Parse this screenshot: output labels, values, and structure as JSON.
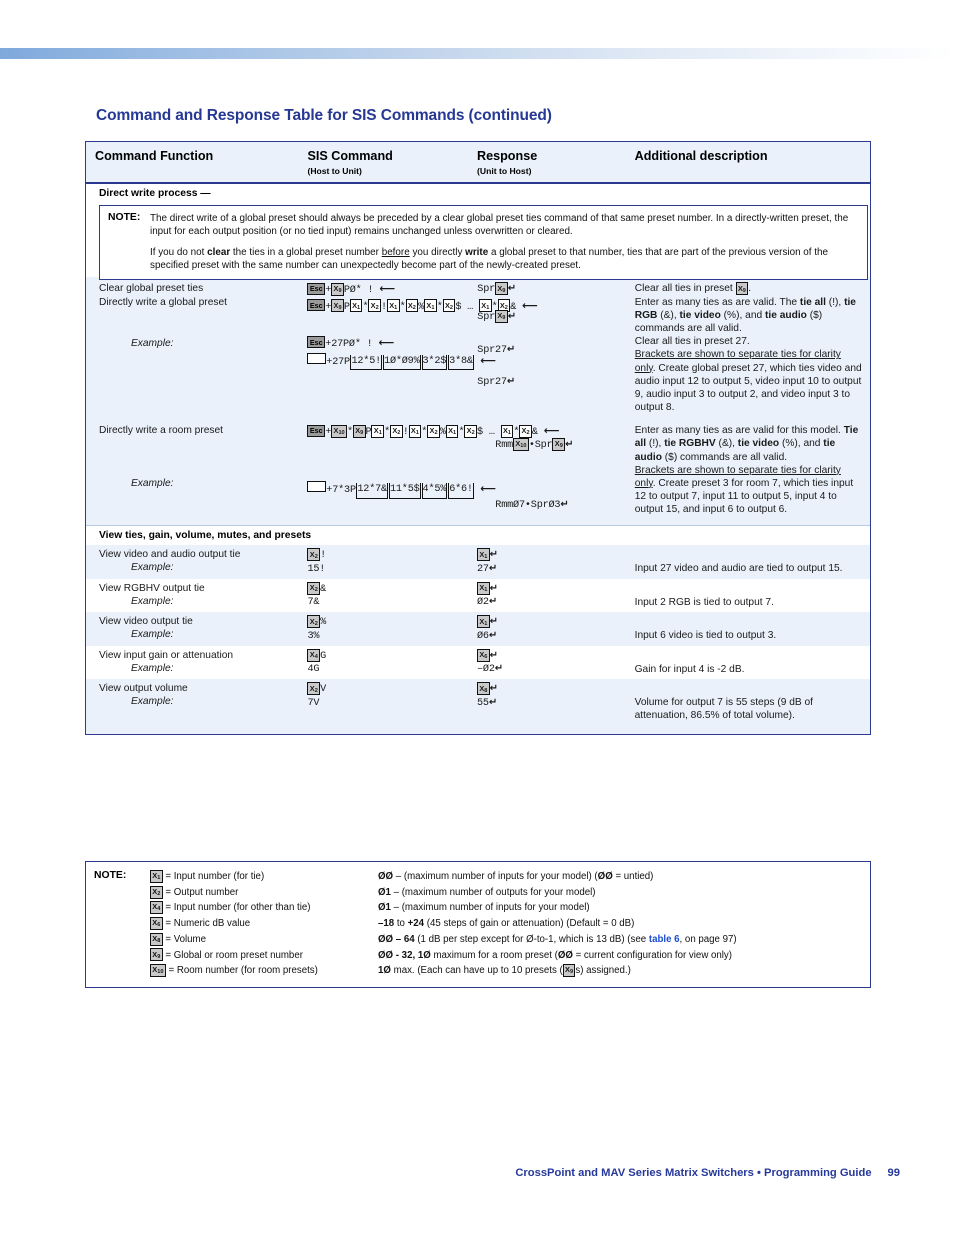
{
  "page": {
    "title": "Command and Response Table for SIS Commands (continued)",
    "footer_text": "CrossPoint and MAV Series Matrix Switchers • Programming Guide",
    "page_number": "99",
    "accent_color": "#26389b",
    "rule_color": "#2b3a8f",
    "shade_color": "#eaf1fa"
  },
  "table": {
    "headers": {
      "col1": "Command Function",
      "col2": "SIS Command",
      "col2_sub": "(Host to Unit)",
      "col3": "Response",
      "col3_sub": "(Unit to Host)",
      "col4": "Additional description"
    },
    "section_direct_write": "Direct write process —",
    "section_view": "View ties, gain, volume, mutes, and presets"
  },
  "note_top": {
    "label": "NOTE:",
    "paragraph1_a": "The direct write of a global preset should always be preceded by a clear global preset ties command of that same preset number. In a directly-written preset, the input for each output position (or no tied input) remains unchanged unless overwritten or cleared.",
    "paragraph2_a": "If you do not ",
    "paragraph2_clear": "clear",
    "paragraph2_b": " the ties in a global preset number ",
    "paragraph2_before": "before",
    "paragraph2_c": " you directly ",
    "paragraph2_write": "write",
    "paragraph2_d": " a global preset to that number, ties that are part of the previous version of the specified preset with the same number can unexpectedly become part of the newly-created preset."
  },
  "rows": {
    "clear_global_preset_ties": {
      "function": "Clear global preset ties",
      "description": "Clear all ties in preset "
    },
    "directly_write_global_preset": {
      "function": "Directly write a global preset",
      "desc_a": "Enter as many ties as are valid. The ",
      "desc_tie_all": "tie all",
      "desc_b": " (!), ",
      "desc_tie_rgb": "tie RGB",
      "desc_c": " (&), ",
      "desc_tie_video": "tie video",
      "desc_d": " (%), and ",
      "desc_tie_audio": "tie audio",
      "desc_e": " ($) commands are all valid."
    },
    "global_example": {
      "label": "Example:",
      "desc_clear": "Clear all ties in preset 27.",
      "desc_brackets": "Brackets are shown to separate ties for clarity only",
      "desc_rest": ". Create global preset 27, which ties video and audio input 12 to output 5, video input 10 to output 9, audio input 3 to output 2, and video input 3 to output 8."
    },
    "directly_write_room_preset": {
      "function": "Directly write a room preset",
      "desc_a": "Enter as many ties as are valid for this model. ",
      "desc_tie_all": "Tie all",
      "desc_b": " (!), ",
      "desc_tie_rgbhv": "tie RGBHV",
      "desc_c": " (&), ",
      "desc_tie_video": "tie video",
      "desc_d": " (%), and ",
      "desc_tie_audio": "tie audio",
      "desc_e": " ($) commands are all valid."
    },
    "room_example": {
      "label": "Example:",
      "desc_brackets": "Brackets are shown to separate ties for clarity only",
      "desc_rest": ". Create preset 3 for room 7, which ties input 12 to output 7, input 11 to output 5, input 4 to output 15, and input 6 to output 6."
    },
    "view_video_audio_tie": {
      "function": "View video and audio output tie",
      "example_label": "Example:",
      "example_sis": "15!",
      "example_resp": "27",
      "example_desc": "Input 27 video and audio are tied to output 15."
    },
    "view_rgbhv_tie": {
      "function": "View RGBHV output tie",
      "example_label": "Example:",
      "example_sis": "7&",
      "example_resp": "Ø2",
      "example_desc": "Input 2 RGB is tied to output 7."
    },
    "view_video_tie": {
      "function": "View video output tie",
      "example_label": "Example:",
      "example_sis": "3%",
      "example_resp": "Ø6",
      "example_desc": "Input 6 video is tied to output 3."
    },
    "view_input_gain": {
      "function": "View input gain or attenuation",
      "example_label": "Example:",
      "example_sis": "4G",
      "example_resp": "–Ø2",
      "example_desc": "Gain for input 4 is -2 dB."
    },
    "view_output_volume": {
      "function": "View output volume",
      "example_label": "Example:",
      "example_sis": "7V",
      "example_resp": "55",
      "example_desc": "Volume for output 7 is 55 steps (9 dB of attenuation, 86.5% of total volume)."
    }
  },
  "note_bottom": {
    "label": "NOTE:",
    "variables": [
      {
        "chip": "X1",
        "sub": "1",
        "text": "= Input number (for tie)"
      },
      {
        "chip": "X2",
        "sub": "2",
        "text": "= Output number"
      },
      {
        "chip": "X4",
        "sub": "4",
        "text": "= Input number (for other than tie)"
      },
      {
        "chip": "X6",
        "sub": "6",
        "text": "= Numeric dB value"
      },
      {
        "chip": "X8",
        "sub": "8",
        "text": "= Volume"
      },
      {
        "chip": "X9",
        "sub": "9",
        "text": "= Global or room preset number"
      },
      {
        "chip": "X10",
        "sub": "10",
        "text": "= Room number (for room presets)"
      }
    ],
    "definitions": {
      "d1_bold": "ØØ",
      "d1_rest": " – (maximum number of inputs for your model)  (",
      "d1_bold2": "ØØ",
      "d1_tail": " = untied)",
      "d2_bold": "Ø1",
      "d2_rest": " – (maximum number of outputs for your model)",
      "d3_bold": "Ø1",
      "d3_rest": " – (maximum number of inputs for your model)",
      "d4_bold": "–18",
      "d4_mid": " to ",
      "d4_bold2": "+24",
      "d4_rest": " (45 steps of gain or attenuation) (Default = 0 dB)",
      "d5_bold": "ØØ – ",
      "d5_bold2": "64",
      "d5_rest": " (1 dB per step except for Ø-to-1, which is 13 dB) (see ",
      "d5_link": "table 6",
      "d5_tail": ", on page 97)",
      "d6_bold": "ØØ - 32, 1Ø",
      "d6_rest": " maximum for a room preset (",
      "d6_bold2": "ØØ",
      "d6_tail": " = current configuration for view only)",
      "d7_bold": "1Ø",
      "d7_rest": " max. (Each can have up to 10 presets (",
      "d7_chip": "X9",
      "d7_tail": "s) assigned.)"
    }
  },
  "sis_literals": {
    "esc": "Esc",
    "plus": "+",
    "p": "P",
    "clear_tail": "PØ* !",
    "spr": "Spr",
    "rmm": "Rmm",
    "global_ex_clear": "+27PØ* !",
    "global_ex_resp1": "Spr27",
    "global_ex_resp2": "Spr27",
    "global_ex_g1": "12*5!",
    "global_ex_g2": "1Ø*Ø9%",
    "global_ex_g3": "3*2$",
    "global_ex_g4": "3*8&",
    "global_ex_pre": "+27P",
    "room_ex_pre": "+7*3P",
    "room_ex_g1": "12*7&",
    "room_ex_g2": "11*5$",
    "room_ex_g3": "4*5%",
    "room_ex_g4": "6*6!",
    "room_ex_resp": "RmmØ7•SprØ3",
    "ellipsis": "...",
    "star": "*",
    "bang": "!",
    "pct": "%",
    "dollar": "$",
    "amp": "&"
  }
}
